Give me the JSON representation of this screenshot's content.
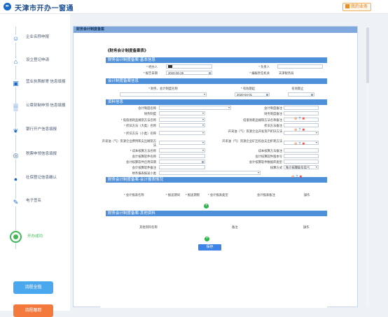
{
  "header": {
    "title": "天津市开办一窗通",
    "logo_glyph": "✒",
    "my_business": "我的业务"
  },
  "sidebar": {
    "steps": [
      {
        "label": "企业名称申报",
        "glyph": "☺",
        "current": false
      },
      {
        "label": "设立登记申请",
        "glyph": "⌂",
        "current": false
      },
      {
        "label": "营业执照邮寄 信息填报",
        "glyph": "▣",
        "current": false
      },
      {
        "label": "公章刻制申领 信息填报",
        "glyph": "▒",
        "current": false
      },
      {
        "label": "银行开户信息填报",
        "glyph": "❦",
        "current": false
      },
      {
        "label": "税票申领信息填报",
        "glyph": "◎",
        "current": false
      },
      {
        "label": "社保登记信息确认",
        "glyph": "●",
        "current": false
      },
      {
        "label": "电子签名",
        "glyph": "✎",
        "current": false
      },
      {
        "label": "开办成功",
        "glyph": "",
        "current": true
      }
    ],
    "process_btn": "流程全揽",
    "follow_btn": "流程跟踪"
  },
  "panel": {
    "title": "财务会计制度备案"
  },
  "form": {
    "doc_title": "《财务会计制度备案表》",
    "sections": {
      "basic": "财务会计制度备案-基本信息",
      "accounting": "会计制度备案信息",
      "data": "资料信息",
      "report": "财务会计制度备案-会计报表情况",
      "other": "财务会计制度备案-其他资料"
    },
    "basic": {
      "operator_label": "* 经办人",
      "operator_value": "██",
      "leader_label": "* 负责人",
      "date_label": "* 报告日期",
      "date_value": "2020-06-29",
      "org_label": "* 编报责任机关",
      "org_value": "天津税务局"
    },
    "accounting": {
      "system_label": "* 财务、会计制度名称",
      "effective_label": "* 有效期起",
      "effective_value": "2020-04-01",
      "expire_label": "有效期止"
    },
    "data": {
      "rows": [
        [
          "会计制度名称",
          "会计制度备注"
        ],
        [
          "财务制度",
          "财务制度备注"
        ],
        [
          "* 低值易耗品摊销方法名称",
          "低值易耗品摊销方法名称备注"
        ],
        [
          "* 折旧方法（大类）名称",
          "折旧方法备注"
        ],
        [
          "* 折旧方法（小类）名称",
          "开采油（气）资源企业开发资产折旧方法"
        ],
        [
          "开采油（气）资源企业费用和支出摊销方法",
          "开采油（气）资源企业矿区权益支出折耗方法"
        ],
        [
          "* 成本核算方法名称",
          "成本核算方法备注"
        ],
        [
          "会计核算软件名称",
          "会计核算软件版本号"
        ],
        [
          "会计核算软件启用日期",
          "会计核算软件数据库类型"
        ],
        [
          "会计核算软件备注",
          "核算方式"
        ],
        [
          "财务报表报送小类",
          ""
        ]
      ],
      "accounting_method_value": "独立核算联负盈亏"
    },
    "report_table": {
      "headers": [
        "* 会计报表名称",
        "* 报送期间",
        "* 报送期限",
        "* 会计报表类型",
        "会计报表备注",
        "操作"
      ]
    },
    "other_table": {
      "headers": [
        "其他资料名称",
        "备注",
        "操作"
      ]
    },
    "save_label": "保存"
  },
  "colors": {
    "brand": "#1d4f91",
    "section": "#4d8fd8",
    "add": "#2eb24a",
    "orange": "#f4793d"
  }
}
